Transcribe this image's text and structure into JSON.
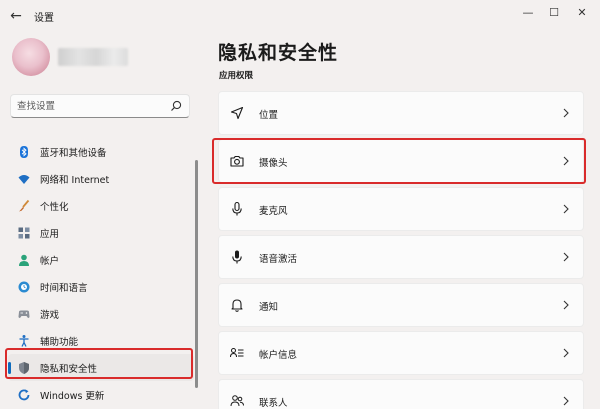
{
  "window": {
    "title": "设置",
    "back_glyph": "←",
    "minimize_glyph": "—",
    "maximize_glyph": "☐",
    "close_glyph": "✕"
  },
  "search": {
    "placeholder": "查找设置"
  },
  "sidebar": {
    "items": [
      {
        "label": "蓝牙和其他设备",
        "icon": "bluetooth-icon"
      },
      {
        "label": "网络和 Internet",
        "icon": "wifi-icon"
      },
      {
        "label": "个性化",
        "icon": "brush-icon"
      },
      {
        "label": "应用",
        "icon": "apps-icon"
      },
      {
        "label": "帐户",
        "icon": "account-icon"
      },
      {
        "label": "时间和语言",
        "icon": "globe-clock-icon"
      },
      {
        "label": "游戏",
        "icon": "gaming-icon"
      },
      {
        "label": "辅助功能",
        "icon": "accessibility-icon"
      },
      {
        "label": "隐私和安全性",
        "icon": "shield-icon",
        "active": true
      },
      {
        "label": "Windows 更新",
        "icon": "windows-update-icon"
      }
    ]
  },
  "main": {
    "title": "隐私和安全性",
    "section": "应用权限",
    "cards": [
      {
        "label": "位置",
        "icon": "location-icon"
      },
      {
        "label": "摄像头",
        "icon": "camera-icon"
      },
      {
        "label": "麦克风",
        "icon": "microphone-icon"
      },
      {
        "label": "语音激活",
        "icon": "voice-activation-icon"
      },
      {
        "label": "通知",
        "icon": "bell-icon"
      },
      {
        "label": "帐户信息",
        "icon": "account-info-icon"
      },
      {
        "label": "联系人",
        "icon": "contacts-icon"
      }
    ]
  },
  "colors": {
    "accent": "#0f6cbd",
    "highlight": "#d92b2b",
    "background": "#f3f0ef"
  }
}
